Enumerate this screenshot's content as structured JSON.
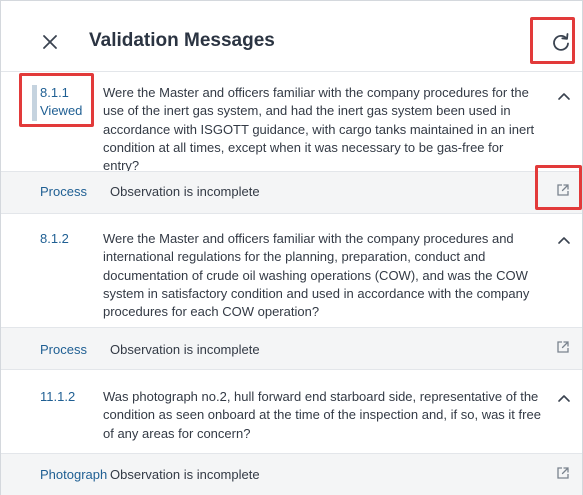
{
  "header": {
    "title": "Validation Messages",
    "close_icon": "close-icon",
    "refresh_icon": "refresh-icon"
  },
  "items": [
    {
      "id": "8.1.1",
      "state": "Viewed",
      "question": "Were the Master and officers familiar with the company procedures for the use of the inert gas system, and had the inert gas system been used in accordance with ISGOTT guidance, with cargo tanks maintained in an inert condition at all times, except when it was necessary to be gas-free for entry?",
      "type": "Process",
      "message": "Observation is incomplete"
    },
    {
      "id": "8.1.2",
      "state": "",
      "question": "Were the Master and officers familiar with the company procedures and international regulations for the planning, preparation, conduct and documentation of crude oil washing operations (COW), and was the COW system in satisfactory condition and used in accordance with the company procedures for each COW operation?",
      "type": "Process",
      "message": "Observation is incomplete"
    },
    {
      "id": "11.1.2",
      "state": "",
      "question": "Was photograph no.2, hull forward end starboard side, representative of the condition as seen onboard at the time of the inspection and, if so, was it free of any areas for concern?",
      "type": "Photograph",
      "message": "Observation is incomplete"
    }
  ],
  "colors": {
    "highlight": "#e23a3a",
    "link": "#1f5f93",
    "summary_bg": "#f4f5f6"
  }
}
